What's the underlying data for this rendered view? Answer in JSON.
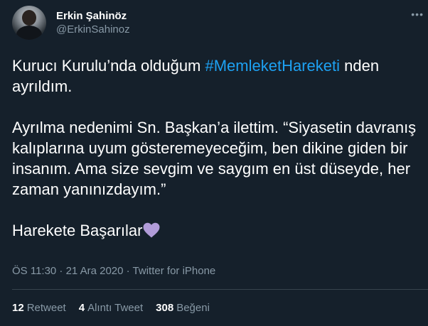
{
  "author": {
    "display_name": "Erkin Şahinöz",
    "handle": "@ErkinSahinoz"
  },
  "tweet": {
    "line1_before": "Kurucı Kurulu’nda olduğum ",
    "hashtag": "#MemleketHareketi",
    "line1_after": " nden ayrıldım.",
    "paragraph2": "Ayrılma nedenimi Sn. Başkan’a ilettim.  “Siyasetin davranış kalıplarına uyum gösteremeyeceğim, ben dikine giden bir insanım. Ama size sevgim ve saygım en üst düseyde, her zaman yanınızdayım.”",
    "paragraph3": "Harekete Başarılar",
    "heart_color": "#b19cd9"
  },
  "meta": {
    "time": "ÖS 11:30 · 21 Ara 2020 · Twitter for iPhone"
  },
  "stats": {
    "retweets_count": "12",
    "retweets_label": "Retweet",
    "quotes_count": "4",
    "quotes_label": "Alıntı Tweet",
    "likes_count": "308",
    "likes_label": "Beğeni"
  },
  "colors": {
    "background": "#15202b",
    "link": "#1da1f2",
    "muted": "#8899a6"
  },
  "icons": {
    "more": "more-icon",
    "heart": "purple-heart-icon"
  }
}
